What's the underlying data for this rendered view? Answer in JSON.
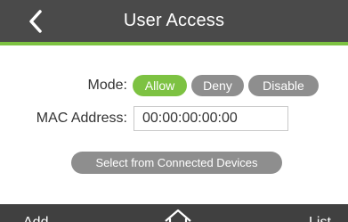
{
  "header": {
    "title": "User Access",
    "back_icon": "chevron-left-icon"
  },
  "form": {
    "mode_label": "Mode:",
    "mode_options": [
      "Allow",
      "Deny",
      "Disable"
    ],
    "mode_selected": "Allow",
    "mac_label": "MAC Address:",
    "mac_value": "00:00:00:00:00",
    "select_button_label": "Select from Connected Devices"
  },
  "footer": {
    "add_label": "Add",
    "home_icon": "home-icon",
    "list_label": "List"
  },
  "colors": {
    "accent": "#7dc242",
    "header_bg": "#4a4a4a",
    "inactive_pill": "#8e8e8e",
    "footer_bg": "#404040"
  }
}
